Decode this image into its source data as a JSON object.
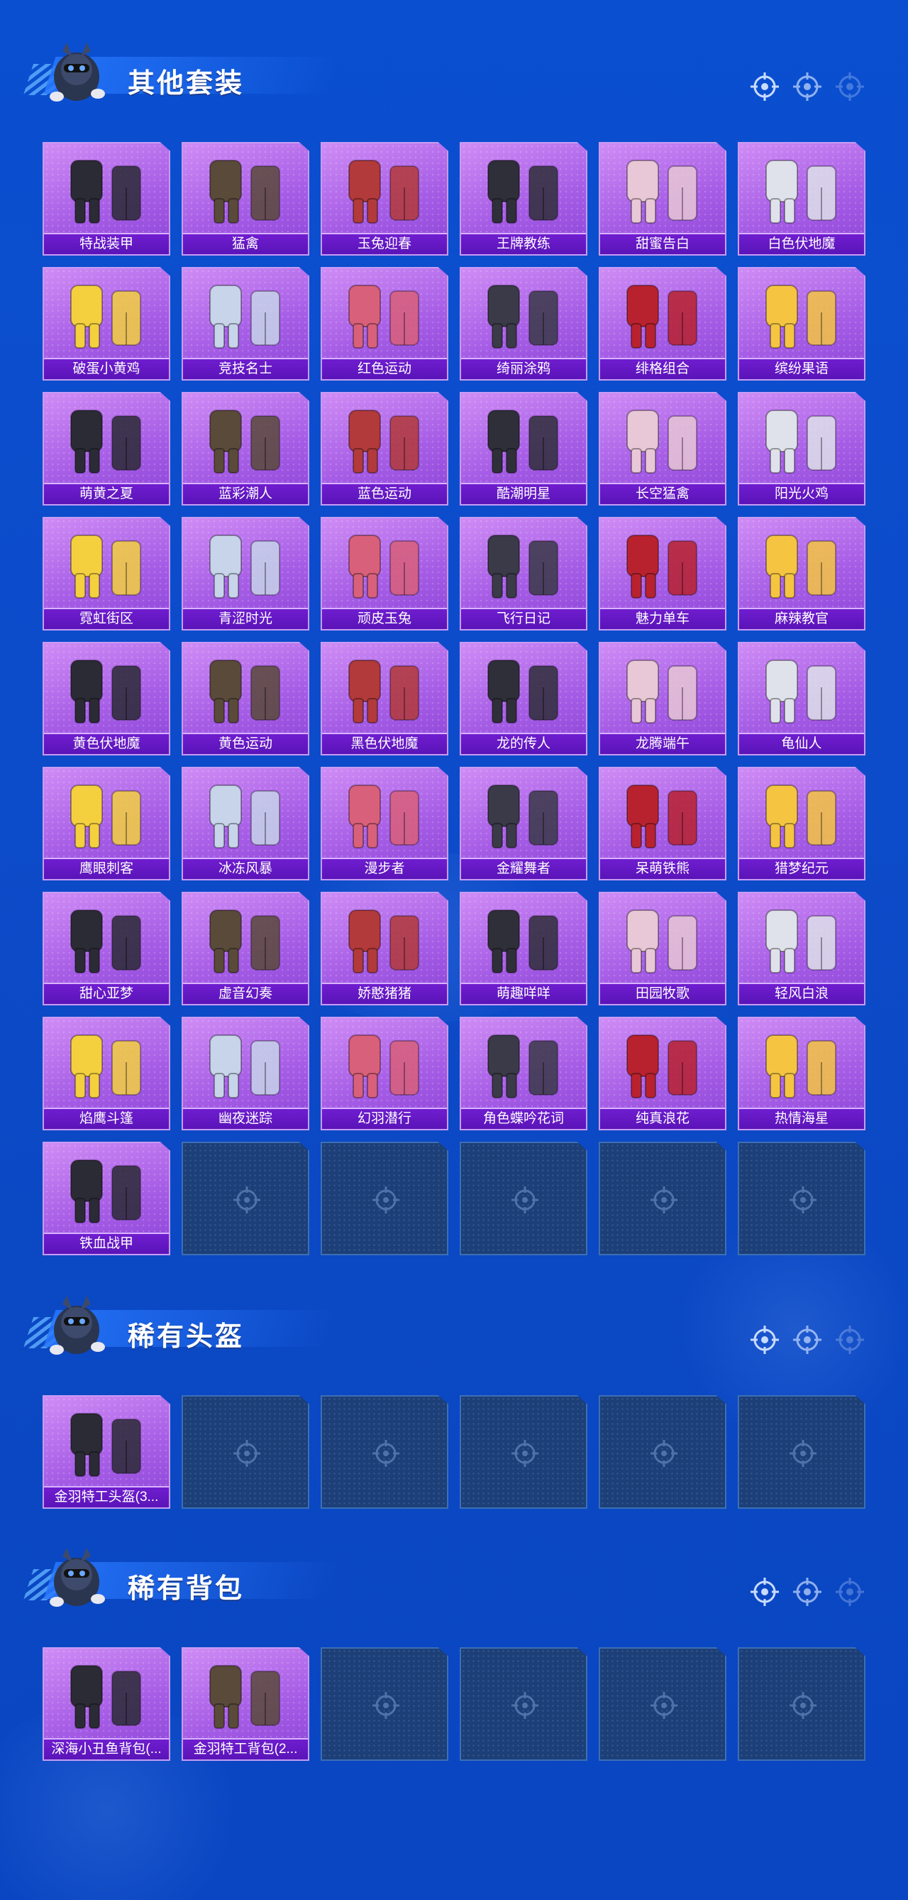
{
  "sections": [
    {
      "title": "其他套装",
      "items": [
        "特战装甲",
        "猛禽",
        "玉兔迎春",
        "王牌教练",
        "甜蜜告白",
        "白色伏地魔",
        "破蛋小黄鸡",
        "竞技名士",
        "红色运动",
        "绮丽涂鸦",
        "绯格组合",
        "缤纷果语",
        "萌黄之夏",
        "蓝彩潮人",
        "蓝色运动",
        "酷潮明星",
        "长空猛禽",
        "阳光火鸡",
        "霓虹街区",
        "青涩时光",
        "顽皮玉兔",
        "飞行日记",
        "魅力单车",
        "麻辣教官",
        "黄色伏地魔",
        "黄色运动",
        "黑色伏地魔",
        "龙的传人",
        "龙腾端午",
        "龟仙人",
        "鹰眼刺客",
        "冰冻风暴",
        "漫步者",
        "金耀舞者",
        "呆萌铁熊",
        "猎梦纪元",
        "甜心亚梦",
        "虚音幻奏",
        "娇憨猪猪",
        "萌趣咩咩",
        "田园牧歌",
        "轻风白浪",
        "焰鹰斗篷",
        "幽夜迷踪",
        "幻羽潜行",
        "角色蝶吟花词",
        "纯真浪花",
        "热情海星",
        "铁血战甲"
      ],
      "empty_slots": 5
    },
    {
      "title": "稀有头盔",
      "items": [
        "金羽特工头盔(3..."
      ],
      "empty_slots": 5
    },
    {
      "title": "稀有背包",
      "items": [
        "深海小丑鱼背包(...",
        "金羽特工背包(2..."
      ],
      "empty_slots": 4
    }
  ],
  "colors": {
    "background": "#0b4bc8",
    "card_purple": "#a75ee6",
    "label_purple": "#6f1dcf",
    "empty_slot": "#1d3f78"
  },
  "icons": {
    "header_mascot": "mascot-icon",
    "header_targets": "crosshair-icon",
    "empty_slot": "crosshair-icon"
  }
}
